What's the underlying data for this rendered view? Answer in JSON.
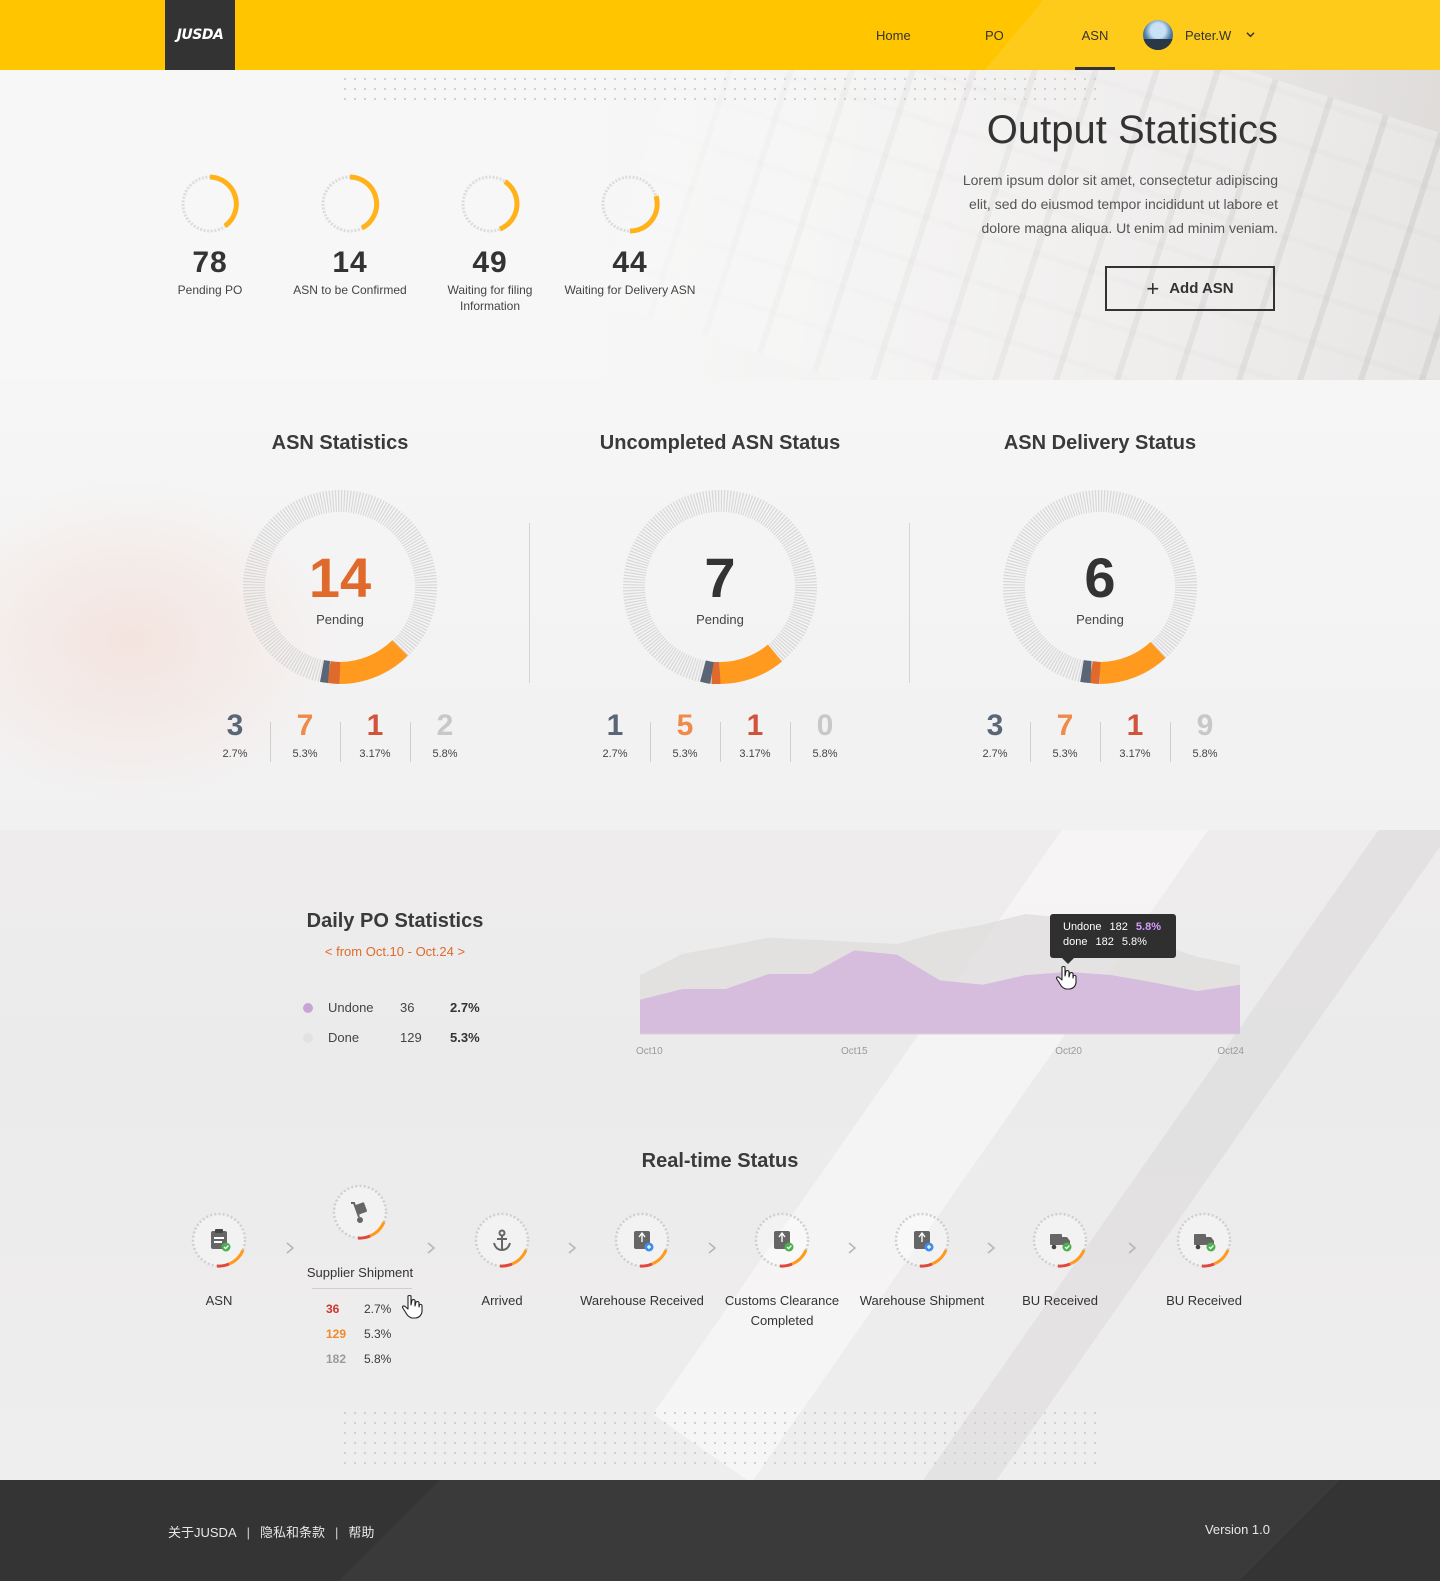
{
  "colors": {
    "brand": "#ffc600",
    "accent_orange": "#ff9a1f",
    "dark": "#333333",
    "undone": "#c9a4d8",
    "done": "#d8d8d8"
  },
  "header": {
    "logo": "JUSDA",
    "nav": [
      {
        "label": "Home"
      },
      {
        "label": "PO"
      },
      {
        "label": "ASN",
        "active": true
      }
    ],
    "user": "Peter.W"
  },
  "hero": {
    "title": "Output Statistics",
    "description": "Lorem ipsum dolor sit amet, consectetur adipiscing elit, sed do eiusmod tempor incididunt ut labore et dolore magna aliqua. Ut enim ad minim veniam.",
    "add_button": "Add ASN",
    "kpis": [
      {
        "value": "78",
        "label": "Pending PO"
      },
      {
        "value": "14",
        "label": "ASN to be Confirmed"
      },
      {
        "value": "49",
        "label": "Waiting for filing Information"
      },
      {
        "value": "44",
        "label": "Waiting for Delivery ASN"
      }
    ]
  },
  "stats": [
    {
      "title": "ASN Statistics",
      "value": "14",
      "value_color": "#e06a2c",
      "label": "Pending",
      "subs": [
        {
          "n": "3",
          "p": "2.7%",
          "color": "#5a6676"
        },
        {
          "n": "7",
          "p": "5.3%",
          "color": "#ef8a4a"
        },
        {
          "n": "1",
          "p": "3.17%",
          "color": "#d0533b"
        },
        {
          "n": "2",
          "p": "5.8%",
          "color": "#c8c8c8"
        }
      ]
    },
    {
      "title": "Uncompleted ASN Status",
      "value": "7",
      "value_color": "#333333",
      "label": "Pending",
      "subs": [
        {
          "n": "1",
          "p": "2.7%",
          "color": "#5a6676"
        },
        {
          "n": "5",
          "p": "5.3%",
          "color": "#ef8a4a"
        },
        {
          "n": "1",
          "p": "3.17%",
          "color": "#d0533b"
        },
        {
          "n": "0",
          "p": "5.8%",
          "color": "#c8c8c8"
        }
      ]
    },
    {
      "title": "ASN Delivery Status",
      "value": "6",
      "value_color": "#333333",
      "label": "Pending",
      "subs": [
        {
          "n": "3",
          "p": "2.7%",
          "color": "#5a6676"
        },
        {
          "n": "7",
          "p": "5.3%",
          "color": "#ef8a4a"
        },
        {
          "n": "1",
          "p": "3.17%",
          "color": "#d0533b"
        },
        {
          "n": "9",
          "p": "5.8%",
          "color": "#c8c8c8"
        }
      ]
    }
  ],
  "daily": {
    "title": "Daily PO Statistics",
    "range": "< from Oct.10 - Oct.24 >",
    "legend": [
      {
        "name": "Undone",
        "count": "36",
        "pct": "2.7%",
        "color": "#c9a4d8"
      },
      {
        "name": "Done",
        "count": "129",
        "pct": "5.3%",
        "color": "#dedede"
      }
    ],
    "tooltip": {
      "undone_label": "Undone",
      "undone_count": "182",
      "undone_pct": "5.8%",
      "done_label": "done",
      "done_count": "182",
      "done_pct": "5.8%"
    },
    "x_labels": [
      "Oct10",
      "Oct15",
      "Oct20",
      "Oct24"
    ]
  },
  "chart_data": {
    "type": "area",
    "x": [
      "Oct10",
      "Oct11",
      "Oct12",
      "Oct13",
      "Oct14",
      "Oct15",
      "Oct16",
      "Oct17",
      "Oct18",
      "Oct19",
      "Oct20",
      "Oct21",
      "Oct22",
      "Oct23",
      "Oct24"
    ],
    "series": [
      {
        "name": "Undone",
        "values": [
          32,
          42,
          42,
          56,
          56,
          78,
          74,
          50,
          46,
          55,
          58,
          55,
          48,
          40,
          46
        ]
      },
      {
        "name": "Done",
        "values": [
          55,
          75,
          82,
          90,
          88,
          86,
          84,
          95,
          102,
          112,
          108,
          96,
          86,
          72,
          64
        ]
      }
    ],
    "xlabel": "",
    "ylabel": "",
    "grid": false
  },
  "realtime": {
    "title": "Real-time Status",
    "steps": [
      {
        "label": "ASN",
        "icon": "clipboard-check-icon"
      },
      {
        "label": "Supplier Shipment",
        "icon": "hand-truck-icon"
      },
      {
        "label": "Arrived",
        "icon": "anchor-icon"
      },
      {
        "label": "Warehouse Received",
        "icon": "warehouse-received-icon"
      },
      {
        "label": "Customs Clearance Completed",
        "icon": "customs-cleared-icon"
      },
      {
        "label": "Warehouse Shipment",
        "icon": "warehouse-shipment-icon"
      },
      {
        "label": "BU Received",
        "icon": "truck-check-icon"
      },
      {
        "label": "BU Received",
        "icon": "truck-check-icon"
      }
    ],
    "detail": [
      {
        "n": "36",
        "p": "2.7%",
        "color": "#d0342c"
      },
      {
        "n": "129",
        "p": "5.3%",
        "color": "#ef8a2a"
      },
      {
        "n": "182",
        "p": "5.8%",
        "color": "#9a9a9a"
      }
    ]
  },
  "footer": {
    "links": [
      "关于JUSDA",
      "隐私和条款",
      "帮助"
    ],
    "version": "Version 1.0"
  }
}
